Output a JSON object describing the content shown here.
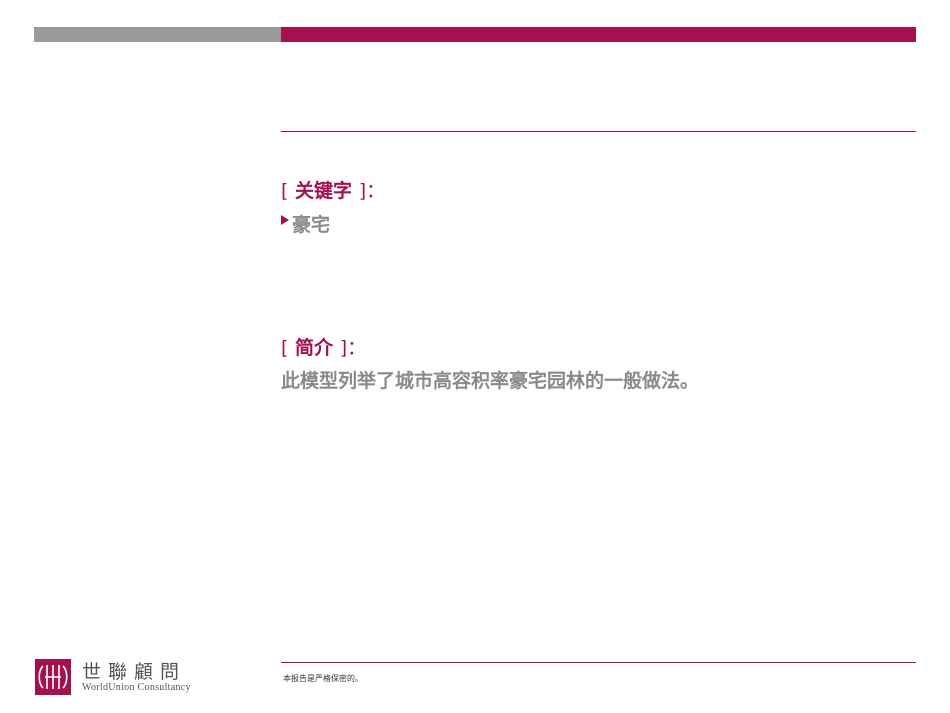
{
  "keywords": {
    "open_bracket": "[",
    "title": "关键字",
    "close_bracket": "]：",
    "items": [
      "豪宅"
    ]
  },
  "intro": {
    "open_bracket": "[",
    "title": "简介",
    "close_bracket": "]：",
    "text": "此模型列举了城市高容积率豪宅园林的一般做法。"
  },
  "footer": {
    "logo_cn": "世聯顧問",
    "logo_en": "WorldUnion Consultancy",
    "confidential": "本报告是严格保密的。"
  },
  "colors": {
    "accent": "#a3114f",
    "gray_bar": "#9b9b9b",
    "text_gray": "#8a8a8a"
  }
}
